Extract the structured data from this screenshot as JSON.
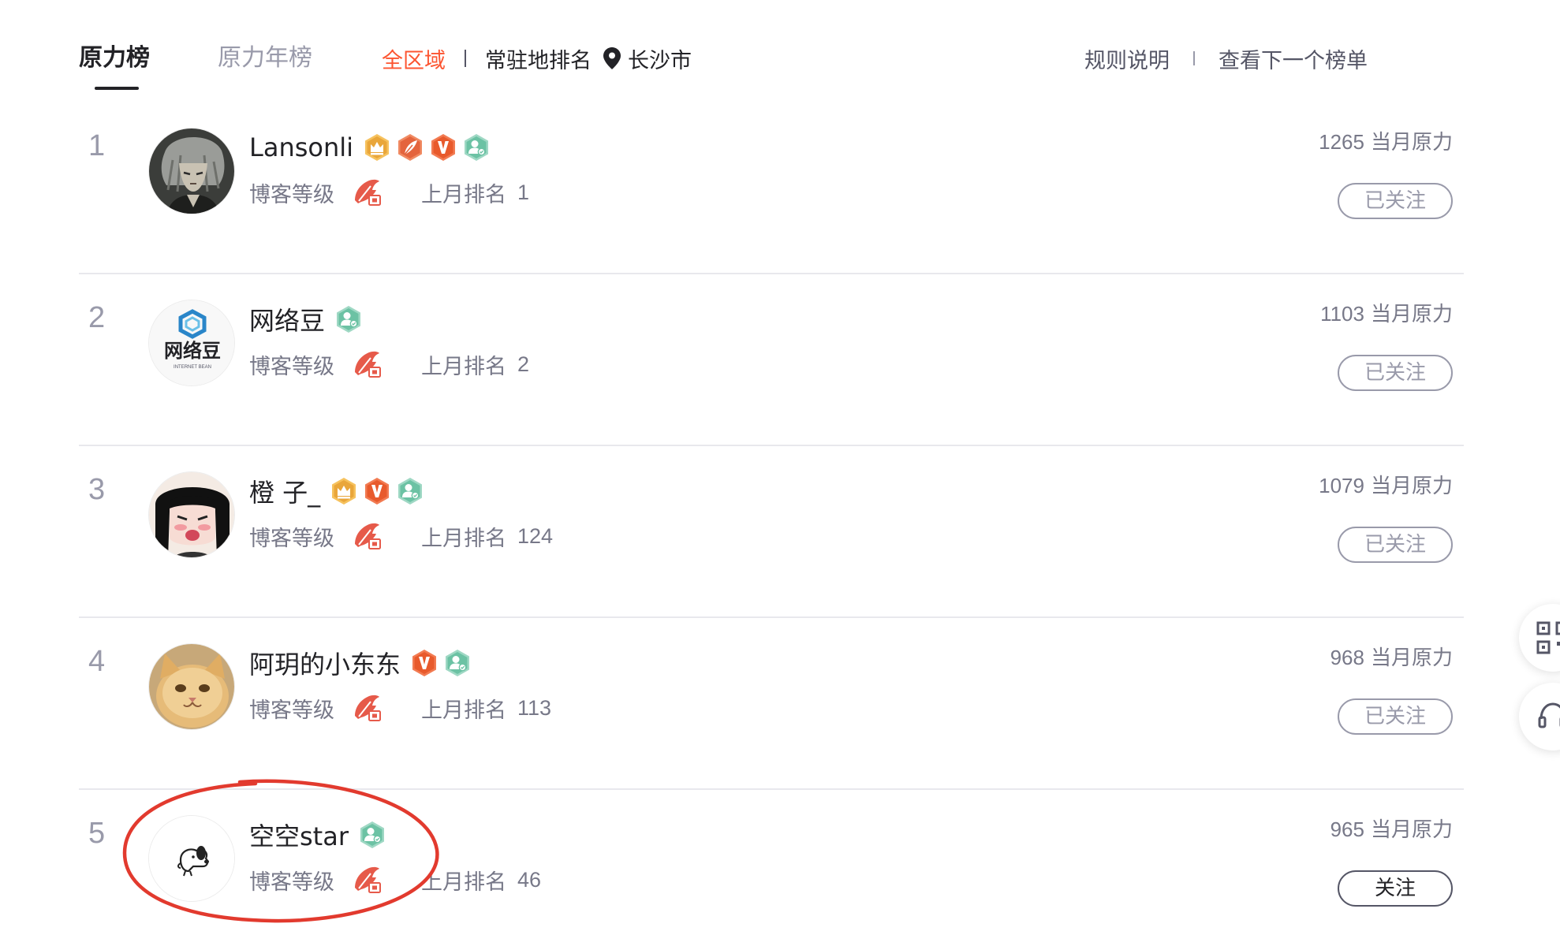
{
  "tabs": {
    "active": "原力榜",
    "inactive": "原力年榜"
  },
  "region": {
    "all": "全区域",
    "resident": "常驻地排名",
    "city": "长沙市"
  },
  "links": {
    "rules": "规则说明",
    "next": "查看下一个榜单"
  },
  "labels": {
    "blog_level": "博客等级",
    "last_month": "上月排名",
    "force_unit": "当月原力"
  },
  "colors": {
    "accent": "#fc5531",
    "annotation": "#e23a2e",
    "text_primary": "#222226",
    "text_secondary": "#777888"
  },
  "rows": [
    {
      "rank": "1",
      "name": "Lansonli",
      "badges": [
        "crown-badge-icon",
        "feather-badge-icon",
        "v-badge-icon",
        "certified-badge-icon"
      ],
      "level_icon": "blog-level-icon",
      "last_rank": "1",
      "force": "1265",
      "follow": "已关注"
    },
    {
      "rank": "2",
      "name": "网络豆",
      "badges": [
        "certified-badge-icon"
      ],
      "level_icon": "blog-level-icon",
      "last_rank": "2",
      "force": "1103",
      "follow": "已关注"
    },
    {
      "rank": "3",
      "name": "橙 子_",
      "badges": [
        "crown-badge-icon",
        "v-badge-icon",
        "certified-badge-icon"
      ],
      "level_icon": "blog-level-icon",
      "last_rank": "124",
      "force": "1079",
      "follow": "已关注"
    },
    {
      "rank": "4",
      "name": "阿玥的小东东",
      "badges": [
        "v-badge-icon",
        "certified-badge-icon"
      ],
      "level_icon": "blog-level-icon",
      "last_rank": "113",
      "force": "968",
      "follow": "已关注"
    },
    {
      "rank": "5",
      "name": "空空star",
      "badges": [
        "certified-badge-icon"
      ],
      "level_icon": "blog-level-icon",
      "last_rank": "46",
      "force": "965",
      "follow": "关注"
    }
  ],
  "avatar_brand": {
    "name": "网络豆",
    "sub": "INTERNET BEAN"
  }
}
